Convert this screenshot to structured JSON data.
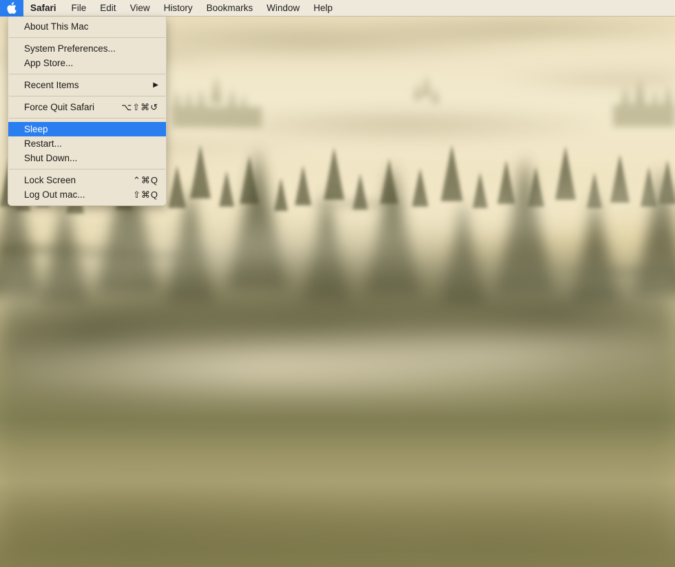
{
  "menubar": {
    "apple_icon": "apple-logo-icon",
    "items": [
      {
        "label": "Safari",
        "bold": true
      },
      {
        "label": "File",
        "bold": false
      },
      {
        "label": "Edit",
        "bold": false
      },
      {
        "label": "View",
        "bold": false
      },
      {
        "label": "History",
        "bold": false
      },
      {
        "label": "Bookmarks",
        "bold": false
      },
      {
        "label": "Window",
        "bold": false
      },
      {
        "label": "Help",
        "bold": false
      }
    ],
    "background_color": "#efe9dc",
    "highlight_color": "#2a7ef0"
  },
  "apple_menu": {
    "groups": [
      {
        "items": [
          {
            "label": "About This Mac",
            "shortcut": "",
            "arrow": "",
            "selected": false
          }
        ]
      },
      {
        "items": [
          {
            "label": "System Preferences...",
            "shortcut": "",
            "arrow": "",
            "selected": false
          },
          {
            "label": "App Store...",
            "shortcut": "",
            "arrow": "",
            "selected": false
          }
        ]
      },
      {
        "items": [
          {
            "label": "Recent Items",
            "shortcut": "",
            "arrow": "▶",
            "selected": false
          }
        ]
      },
      {
        "items": [
          {
            "label": "Force Quit Safari",
            "shortcut": "⌥⇧⌘↺",
            "arrow": "",
            "selected": false
          }
        ]
      },
      {
        "items": [
          {
            "label": "Sleep",
            "shortcut": "",
            "arrow": "",
            "selected": true
          },
          {
            "label": "Restart...",
            "shortcut": "",
            "arrow": "",
            "selected": false
          },
          {
            "label": "Shut Down...",
            "shortcut": "",
            "arrow": "",
            "selected": false
          }
        ]
      },
      {
        "items": [
          {
            "label": "Lock Screen",
            "shortcut": "⌃⌘Q",
            "arrow": "",
            "selected": false
          },
          {
            "label": "Log Out mac...",
            "shortcut": "⇧⌘Q",
            "arrow": "",
            "selected": false
          }
        ]
      }
    ],
    "background_color": "#ece4d2",
    "selected_color": "#2a7ef0"
  },
  "desktop": {
    "wallpaper_description": "Sepia-toned misty conifer forest at sunrise with fog and light rays",
    "dominant_colors": [
      "#f2e9cd",
      "#cbbf9a",
      "#8e8b5d",
      "#5a5a3c"
    ]
  }
}
